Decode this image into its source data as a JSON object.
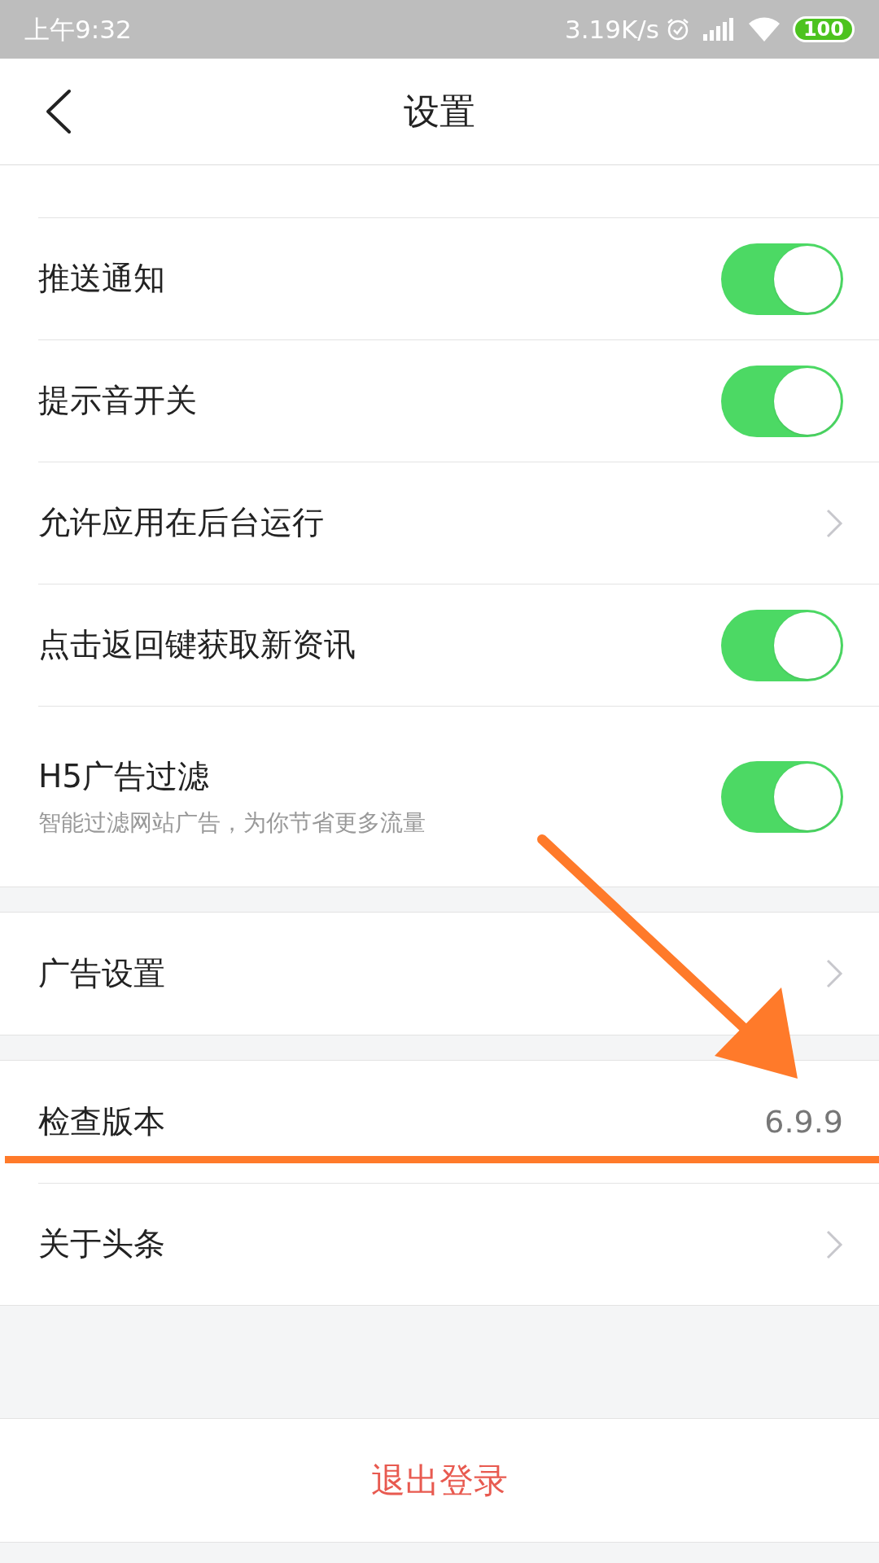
{
  "status_bar": {
    "time": "上午9:32",
    "speed": "3.19K/s",
    "battery": "100"
  },
  "header": {
    "title": "设置"
  },
  "groups": [
    {
      "rows": [
        {
          "kind": "toggle",
          "label": "推送通知",
          "on": true
        },
        {
          "kind": "toggle",
          "label": "提示音开关",
          "on": true
        },
        {
          "kind": "link",
          "label": "允许应用在后台运行"
        },
        {
          "kind": "toggle",
          "label": "点击返回键获取新资讯",
          "on": true
        },
        {
          "kind": "toggle",
          "label": "H5广告过滤",
          "subtitle": "智能过滤网站广告，为你节省更多流量",
          "on": true
        }
      ]
    },
    {
      "rows": [
        {
          "kind": "link",
          "label": "广告设置"
        }
      ]
    },
    {
      "rows": [
        {
          "kind": "value",
          "label": "检查版本",
          "value": "6.9.9"
        },
        {
          "kind": "link",
          "label": "关于头条"
        }
      ]
    }
  ],
  "logout": {
    "label": "退出登录"
  }
}
